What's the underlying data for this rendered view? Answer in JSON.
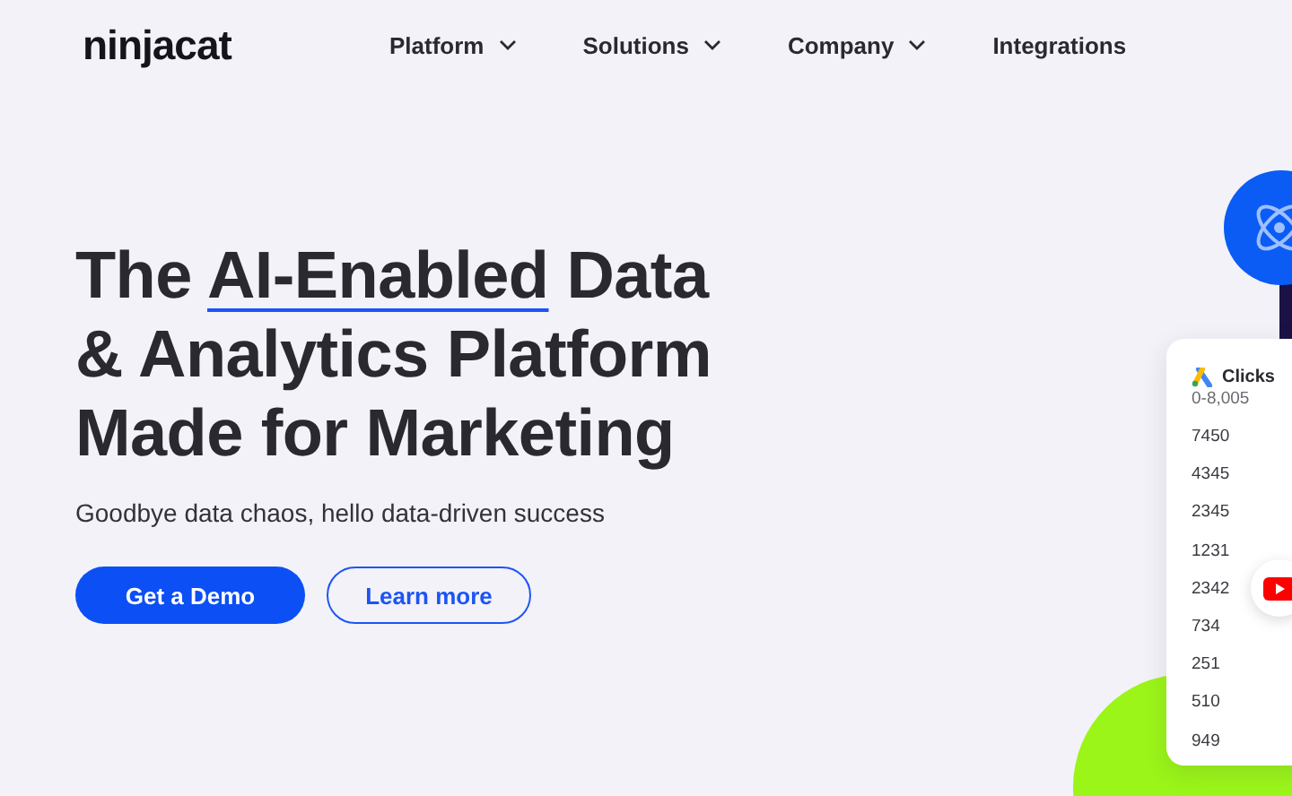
{
  "header": {
    "logo": "ninjacat",
    "nav": [
      {
        "label": "Platform",
        "has_menu": true
      },
      {
        "label": "Solutions",
        "has_menu": true
      },
      {
        "label": "Company",
        "has_menu": true
      },
      {
        "label": "Integrations",
        "has_menu": false
      }
    ]
  },
  "hero": {
    "headline": {
      "before": "The ",
      "highlight": "AI-Enabled",
      "after": " Data & Analytics Platform Made for Marketing"
    },
    "subtitle": "Goodbye data chaos, hello data-driven success",
    "buttons": [
      {
        "label": "Get a Demo",
        "kind": "primary"
      },
      {
        "label": "Learn more",
        "kind": "outline"
      }
    ]
  },
  "metric_card": {
    "title": "Clicks",
    "range": "0-8,005",
    "values": [
      "7450",
      "4345",
      "2345",
      "1231",
      "2342",
      "734",
      "251",
      "510",
      "949"
    ]
  }
}
